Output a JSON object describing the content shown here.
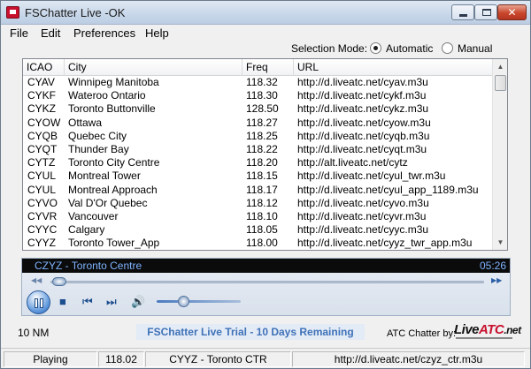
{
  "window": {
    "title": "FSChatter Live -OK"
  },
  "menu": [
    "File",
    "Edit",
    "Preferences",
    "Help"
  ],
  "selection_mode": {
    "label": "Selection Mode:",
    "options": [
      "Automatic",
      "Manual"
    ],
    "selected": "Automatic"
  },
  "list": {
    "columns": [
      "ICAO",
      "City",
      "Freq",
      "URL"
    ],
    "rows": [
      {
        "icao": "CYAV",
        "city": "Winnipeg Manitoba",
        "freq": "118.32",
        "url": "http://d.liveatc.net/cyav.m3u"
      },
      {
        "icao": "CYKF",
        "city": "Wateroo Ontario",
        "freq": "118.30",
        "url": "http://d.liveatc.net/cykf.m3u"
      },
      {
        "icao": "CYKZ",
        "city": "Toronto Buttonville",
        "freq": "128.50",
        "url": "http://d.liveatc.net/cykz.m3u"
      },
      {
        "icao": "CYOW",
        "city": "Ottawa",
        "freq": "118.27",
        "url": "http://d.liveatc.net/cyow.m3u"
      },
      {
        "icao": "CYQB",
        "city": "Quebec City",
        "freq": "118.25",
        "url": "http://d.liveatc.net/cyqb.m3u"
      },
      {
        "icao": "CYQT",
        "city": "Thunder Bay",
        "freq": "118.22",
        "url": "http://d.liveatc.net/cyqt.m3u"
      },
      {
        "icao": "CYTZ",
        "city": "Toronto City Centre",
        "freq": "118.20",
        "url": "http://alt.liveatc.net/cytz"
      },
      {
        "icao": "CYUL",
        "city": "Montreal Tower",
        "freq": "118.15",
        "url": "http://d.liveatc.net/cyul_twr.m3u"
      },
      {
        "icao": "CYUL",
        "city": "Montreal Approach",
        "freq": "118.17",
        "url": "http://d.liveatc.net/cyul_app_1189.m3u"
      },
      {
        "icao": "CYVO",
        "city": "Val D'Or Quebec",
        "freq": "118.12",
        "url": "http://d.liveatc.net/cyvo.m3u"
      },
      {
        "icao": "CYVR",
        "city": "Vancouver",
        "freq": "118.10",
        "url": "http://d.liveatc.net/cyvr.m3u"
      },
      {
        "icao": "CYYC",
        "city": "Calgary",
        "freq": "118.05",
        "url": "http://d.liveatc.net/cyyc.m3u"
      },
      {
        "icao": "CYYZ",
        "city": "Toronto Tower_App",
        "freq": "118.00",
        "url": "http://d.liveatc.net/cyyz_twr_app.m3u"
      }
    ]
  },
  "player": {
    "now_playing": "CZYZ - Toronto Centre",
    "time": "05:26",
    "state": "paused",
    "seek_fraction": 0.02,
    "volume_fraction": 0.32
  },
  "footer": {
    "range": "10 NM",
    "trial_text": "FSChatter Live Trial - 10 Days Remaining",
    "atc_label": "ATC Chatter by:",
    "logo": {
      "part1": "Live",
      "part2": "ATC",
      "part3": ".net"
    }
  },
  "status": {
    "state": "Playing",
    "freq": "118.02",
    "station": "CYYZ - Toronto CTR",
    "url": "http://d.liveatc.net/czyz_ctr.m3u"
  },
  "colors": {
    "accent": "#3f72b8",
    "now_playing_text": "#7fb4ff",
    "logo_red": "#c8102e"
  }
}
